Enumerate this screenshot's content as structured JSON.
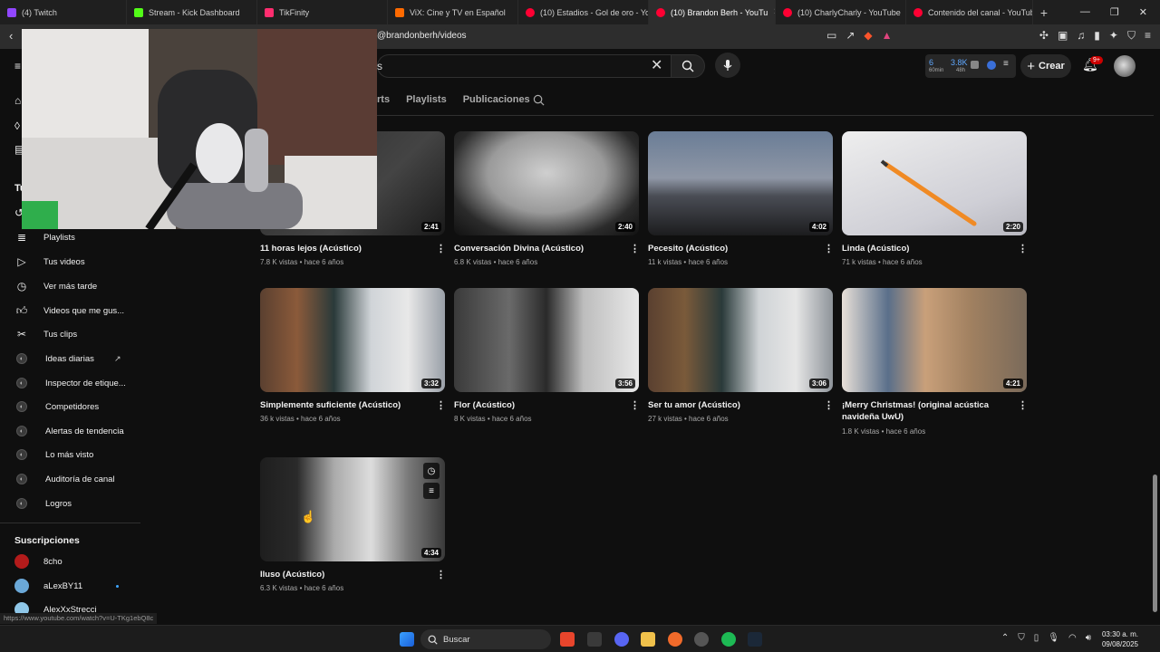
{
  "browser": {
    "tabs": [
      {
        "title": "(4) Twitch",
        "color": "#9146ff",
        "active": false
      },
      {
        "title": "Stream - Kick Dashboard",
        "color": "#53fc18",
        "active": false
      },
      {
        "title": "TikFinity",
        "color": "#ff2d6f",
        "active": false
      },
      {
        "title": "ViX: Cine y TV en Español",
        "color": "#ff6a00",
        "active": false
      },
      {
        "title": "(10) Estadios - Gol de oro - Yo",
        "color": "#ff0033",
        "active": false
      },
      {
        "title": "(10) Brandon Berh - YouTu",
        "color": "#ff0033",
        "active": true
      },
      {
        "title": "(10) CharlyCharly - YouTube",
        "color": "#ff0033",
        "active": false
      },
      {
        "title": "Contenido del canal - YouTube",
        "color": "#ff0033",
        "active": false
      }
    ],
    "url": "@brandonberh/videos",
    "status_url": "https://www.youtube.com/watch?v=U-TKg1ebQ8c"
  },
  "header": {
    "search_query": "s",
    "stats": {
      "a": "6",
      "a_sub": "60min",
      "b": "3.8K",
      "b_sub": "48h"
    },
    "create_label": "Crear",
    "notif_badge": "9+"
  },
  "channel_tabs": [
    "rts",
    "Playlists",
    "Publicaciones"
  ],
  "sidebar": {
    "partial_heading": "Tu",
    "items": [
      {
        "label": "Playlists",
        "icon": "playlist-icon"
      },
      {
        "label": "Tus videos",
        "icon": "video-icon"
      },
      {
        "label": "Ver más tarde",
        "icon": "clock-icon"
      },
      {
        "label": "Videos que me gus...",
        "icon": "like-icon"
      },
      {
        "label": "Tus clips",
        "icon": "scissors-icon"
      }
    ],
    "ext_items": [
      {
        "label": "Ideas diarias",
        "external": true
      },
      {
        "label": "Inspector de etique...",
        "external": false
      },
      {
        "label": "Competidores",
        "external": false
      },
      {
        "label": "Alertas de tendencia",
        "external": false
      },
      {
        "label": "Lo más visto",
        "external": false
      },
      {
        "label": "Auditoría de canal",
        "external": false
      },
      {
        "label": "Logros",
        "external": false
      }
    ],
    "subs_title": "Suscripciones",
    "subscriptions": [
      {
        "name": "8cho",
        "color": "#b31b1b",
        "live": false
      },
      {
        "name": "aLexBY11",
        "color": "#6aa8d8",
        "live": true
      },
      {
        "name": "AlexXxStrecci",
        "color": "#8fc7e8",
        "live": false
      }
    ]
  },
  "videos": [
    {
      "title": "11 horas lejos (Acústico)",
      "title2": "",
      "views": "7.8 K vistas",
      "age": "hace 6 años",
      "duration": "2:41"
    },
    {
      "title": "Conversación Divina (Acústico)",
      "title2": "",
      "views": "6.8 K vistas",
      "age": "hace 6 años",
      "duration": "2:40"
    },
    {
      "title": "Pecesito (Acústico)",
      "title2": "",
      "views": "11 k vistas",
      "age": "hace 6 años",
      "duration": "4:02"
    },
    {
      "title": "Linda (Acústico)",
      "title2": "",
      "views": "71 k vistas",
      "age": "hace 6 años",
      "duration": "2:20"
    },
    {
      "title": "Simplemente suficiente (Acústico)",
      "title2": "",
      "views": "36 k vistas",
      "age": "hace 6 años",
      "duration": "3:32"
    },
    {
      "title": "Flor (Acústico)",
      "title2": "",
      "views": "8 K vistas",
      "age": "hace 6 años",
      "duration": "3:56"
    },
    {
      "title": "Ser tu amor (Acústico)",
      "title2": "",
      "views": "27 k vistas",
      "age": "hace 6 años",
      "duration": "3:06"
    },
    {
      "title": "¡Merry Christmas! (original acústica",
      "title2": "navideña UwU)",
      "views": "1.8 K vistas",
      "age": "hace 6 años",
      "duration": "4:21"
    },
    {
      "title": "Iluso (Acústico)",
      "title2": "",
      "views": "6.3 K vistas",
      "age": "hace 6 años",
      "duration": "4:34"
    }
  ],
  "taskbar": {
    "search_label": "Buscar",
    "time": "03:30 a. m.",
    "date": "09/08/2025"
  }
}
